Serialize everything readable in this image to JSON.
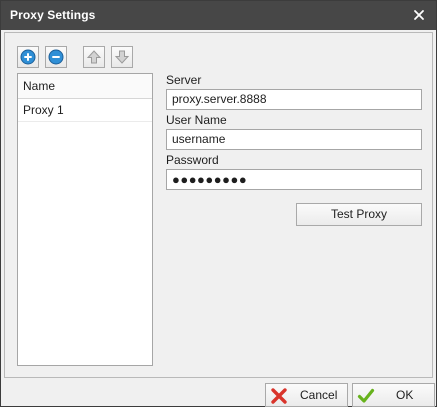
{
  "window": {
    "title": "Proxy Settings",
    "close_icon": "close-icon"
  },
  "toolbar": {
    "add_icon": "plus-circle-icon",
    "remove_icon": "minus-circle-icon",
    "move_up_icon": "arrow-up-icon",
    "move_down_icon": "arrow-down-icon"
  },
  "proxy_list": {
    "header": "Name",
    "items": [
      {
        "label": "Proxy 1"
      }
    ]
  },
  "form": {
    "server_label": "Server",
    "server_value": "proxy.server.8888",
    "username_label": "User Name",
    "username_value": "username",
    "password_label": "Password",
    "password_value": "●●●●●●●●●",
    "test_button": "Test Proxy"
  },
  "footer": {
    "cancel_label": "Cancel",
    "ok_label": "OK"
  },
  "colors": {
    "titlebar": "#474747",
    "add_remove_blue": "#2f8fd6",
    "cancel_red": "#d9342b",
    "ok_green": "#67b21d"
  }
}
